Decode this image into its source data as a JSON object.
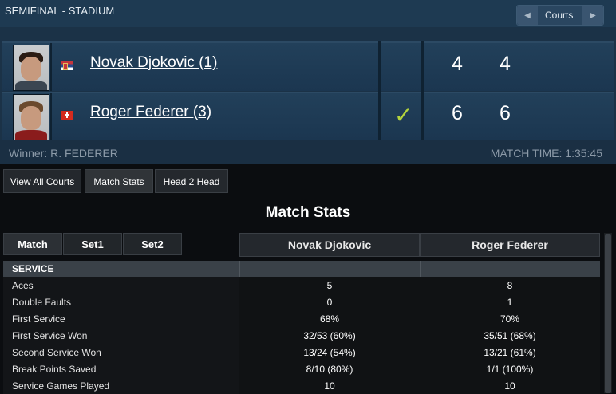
{
  "header": {
    "round_title": "SEMIFINAL - STADIUM",
    "courts_label": "Courts",
    "prev_icon": "◀",
    "next_icon": "▶"
  },
  "players": [
    {
      "name": "Novak Djokovic (1)",
      "flag": "serbia-flag-icon",
      "sets": [
        "4",
        "4"
      ],
      "winner": false
    },
    {
      "name": "Roger Federer (3)",
      "flag": "switzerland-flag-icon",
      "sets": [
        "6",
        "6"
      ],
      "winner": true,
      "check": "✓"
    }
  ],
  "result": {
    "winner_text": "Winner: R. FEDERER",
    "match_time": "MATCH TIME: 1:35:45"
  },
  "tabs": [
    "View All Courts",
    "Match Stats",
    "Head 2 Head"
  ],
  "stats": {
    "title": "Match Stats",
    "sub_tabs": [
      "Match",
      "Set1",
      "Set2"
    ],
    "columns": [
      "Novak Djokovic",
      "Roger Federer"
    ],
    "section": "SERVICE",
    "rows": [
      {
        "label": "Aces",
        "p1": "5",
        "p2": "8"
      },
      {
        "label": "Double Faults",
        "p1": "0",
        "p2": "1"
      },
      {
        "label": "First Service",
        "p1": "68%",
        "p2": "70%"
      },
      {
        "label": "First Service Won",
        "p1": "32/53 (60%)",
        "p2": "35/51 (68%)"
      },
      {
        "label": "Second Service Won",
        "p1": "13/24 (54%)",
        "p2": "13/21 (61%)"
      },
      {
        "label": "Break Points Saved",
        "p1": "8/10 (80%)",
        "p2": "1/1 (100%)"
      },
      {
        "label": "Service Games Played",
        "p1": "10",
        "p2": "10"
      }
    ]
  },
  "colors": {
    "panel": "#1b3247",
    "check": "#b4d43c",
    "background": "#0b0d10"
  }
}
